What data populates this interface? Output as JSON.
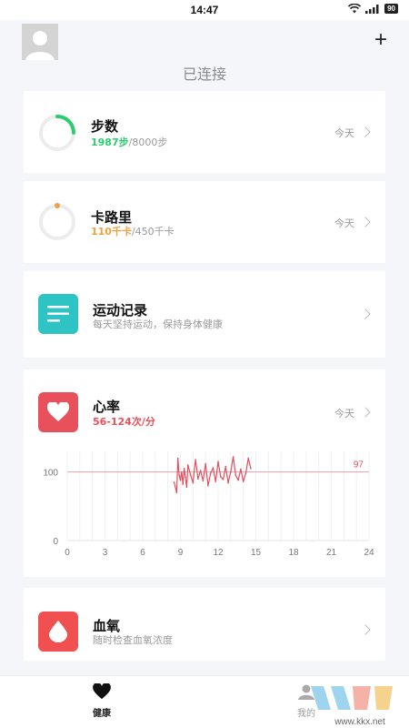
{
  "status_bar": {
    "time": "14:47",
    "battery": "90"
  },
  "header": {
    "connection_status": "已连接"
  },
  "steps_card": {
    "title": "步数",
    "current": "1987步",
    "goal": "/8000步",
    "period": "今天",
    "progress": 0.248,
    "color": "#2ecc71"
  },
  "calories_card": {
    "title": "卡路里",
    "current": "110千卡",
    "goal": "/450千卡",
    "period": "今天",
    "progress": 0.244,
    "color": "#f0a040"
  },
  "exercise_card": {
    "title": "运动记录",
    "subtitle": "每天坚持运动，保持身体健康",
    "icon": "list-icon",
    "color": "#2ec4c4"
  },
  "heart_card": {
    "title": "心率",
    "range": "56-124次/分",
    "period": "今天",
    "icon": "heart-icon",
    "color": "#e8505b"
  },
  "oxygen_card": {
    "title": "血氧",
    "subtitle": "随时检查血氧浓度",
    "icon": "drop-icon",
    "color": "#f05050"
  },
  "tabs": [
    {
      "label": "健康",
      "icon": "heart-icon",
      "active": true
    },
    {
      "label": "我的",
      "icon": "user-icon",
      "active": false
    }
  ],
  "watermark": {
    "text": "KK下载",
    "url": "www.kkx.net"
  },
  "chart_data": {
    "type": "line",
    "x_ticks": [
      "0",
      "3",
      "6",
      "9",
      "12",
      "15",
      "18",
      "21",
      "24"
    ],
    "y_ticks": [
      "100",
      "0"
    ],
    "xlim": [
      0,
      24
    ],
    "ylim": [
      0,
      130
    ],
    "reference_line": {
      "value": 100,
      "label": "97"
    },
    "series": [
      {
        "color": "#e05060",
        "x": [
          8.5,
          8.7,
          8.8,
          8.9,
          9.0,
          9.1,
          9.2,
          9.3,
          9.4,
          9.5,
          9.6,
          9.8,
          10.0,
          10.2,
          10.4,
          10.6,
          10.8,
          11.0,
          11.2,
          11.4,
          11.6,
          11.8,
          12.0,
          12.2,
          12.4,
          12.6,
          12.8,
          13.0,
          13.2,
          13.4,
          13.6,
          13.8,
          14.0,
          14.2,
          14.4,
          14.6
        ],
        "y": [
          85,
          70,
          120,
          95,
          88,
          100,
          82,
          105,
          92,
          78,
          110,
          96,
          84,
          118,
          90,
          102,
          87,
          112,
          80,
          98,
          106,
          86,
          115,
          93,
          89,
          108,
          84,
          100,
          122,
          95,
          88,
          104,
          86,
          98,
          120,
          105
        ]
      }
    ]
  }
}
